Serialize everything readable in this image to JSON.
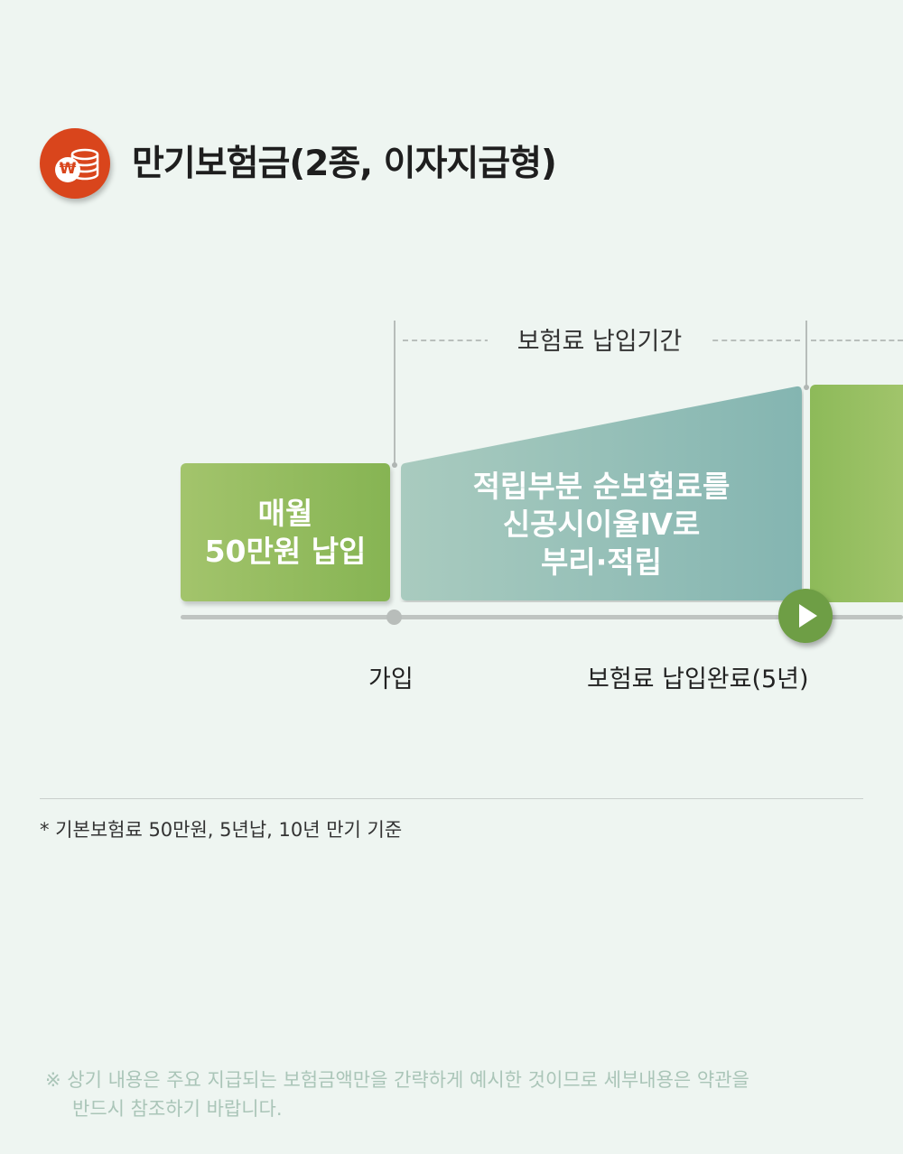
{
  "header": {
    "title": "만기보험금(2종, 이자지급형)",
    "badge_symbol": "₩",
    "badge_icon": "coin-stack-icon",
    "badge_color": "#d9451c"
  },
  "diagram": {
    "period_label": "보험료 납입기간",
    "monthly_box": {
      "line1": "매월",
      "line2": "50만원 납입",
      "color": "#8fb95b"
    },
    "accum_box": {
      "line1": "적립부분 순보험료를",
      "line2": "신공시이율Ⅳ로",
      "line3": "부리·적립",
      "color": "#8ab7b0"
    },
    "axis": {
      "start_label": "가입",
      "end_label": "보험료 납입완료(5년)"
    },
    "play_icon": "play-icon",
    "accent_green": "#6e9e45"
  },
  "notes": {
    "basis": "* 기본보험료 50만원, 5년납, 10년 만기 기준",
    "disclaimer_line1": "※ 상기 내용은 주요 지급되는 보험금액만을 간략하게 예시한 것이므로 세부내용은 약관을",
    "disclaimer_line2": "반드시 참조하기 바랍니다."
  }
}
